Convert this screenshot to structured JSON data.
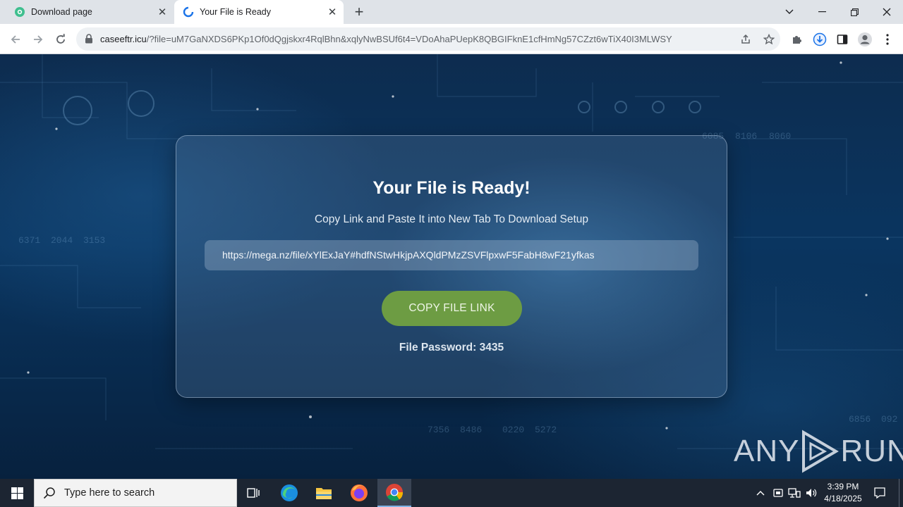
{
  "browser": {
    "tabs": [
      {
        "title": "Download page",
        "icon": "globe-icon",
        "active": false
      },
      {
        "title": "Your File is Ready",
        "icon": "loading-spinner-icon",
        "active": true
      }
    ],
    "url_host": "caseeftr.icu",
    "url_path": "/?file=uM7GaNXDS6PKp1Of0dQgjskxr4RqlBhn&xqlyNwBSUf6t4=VDoAhaPUepK8QBGIFknE1cfHmNg57CZzt6wTiX40I3MLWSY"
  },
  "card": {
    "title": "Your File is Ready!",
    "subtitle": "Copy Link and Paste It into New Tab To Download Setup",
    "link": "https://mega.nz/file/xYlExJaY#hdfNStwHkjpAXQldPMzZSVFlpxwF5FabH8wF21yfkas",
    "button_label": "COPY FILE LINK",
    "password_label": "File Password: ",
    "password_value": "3435"
  },
  "background": {
    "numbers": [
      "6085",
      "8106",
      "8060",
      "7356",
      "8486",
      "0220",
      "5272",
      "6856",
      "092",
      "6371",
      "2044",
      "3153"
    ]
  },
  "watermark": {
    "left": "ANY",
    "right": "RUN"
  },
  "taskbar": {
    "search_placeholder": "Type here to search",
    "time": "3:39 PM",
    "date": "4/18/2025"
  },
  "colors": {
    "button_green": "#6d9c43",
    "page_blue": "#0a3560",
    "taskbar": "#1c2532"
  }
}
